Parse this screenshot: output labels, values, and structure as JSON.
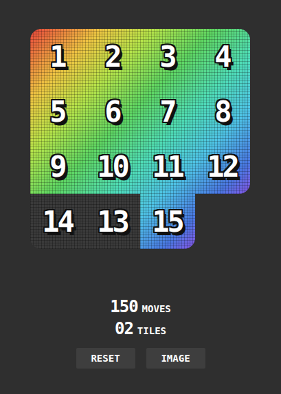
{
  "board": {
    "tiles": [
      {
        "label": "1",
        "correct": true
      },
      {
        "label": "2",
        "correct": true
      },
      {
        "label": "3",
        "correct": true
      },
      {
        "label": "4",
        "correct": true
      },
      {
        "label": "5",
        "correct": true
      },
      {
        "label": "6",
        "correct": true
      },
      {
        "label": "7",
        "correct": true
      },
      {
        "label": "8",
        "correct": true
      },
      {
        "label": "9",
        "correct": true
      },
      {
        "label": "10",
        "correct": true
      },
      {
        "label": "11",
        "correct": true
      },
      {
        "label": "12",
        "correct": true
      },
      {
        "label": "14",
        "correct": false
      },
      {
        "label": "13",
        "correct": false
      },
      {
        "label": "15",
        "correct": true
      },
      {
        "empty": true
      }
    ]
  },
  "stats": {
    "moves": "150",
    "moves_label": "MOVES",
    "tiles": "02",
    "tiles_label": "TILES"
  },
  "buttons": [
    "RESET",
    "IMAGE"
  ]
}
